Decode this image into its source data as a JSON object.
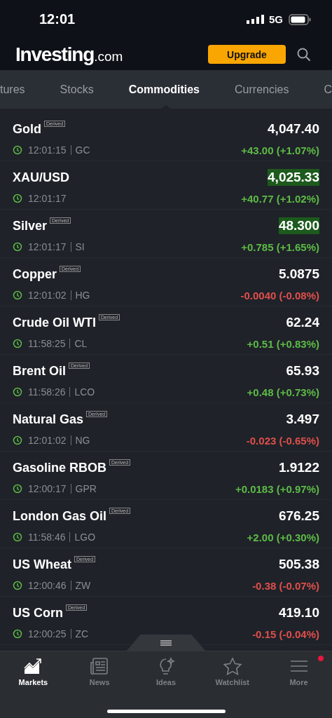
{
  "status_bar": {
    "time": "12:01",
    "network": "5G"
  },
  "header": {
    "logo_main": "Investing",
    "logo_suffix": ".com",
    "upgrade_button": "Upgrade"
  },
  "tabs": [
    {
      "label": "tures",
      "selected": false
    },
    {
      "label": "Stocks",
      "selected": false
    },
    {
      "label": "Commodities",
      "selected": true
    },
    {
      "label": "Currencies",
      "selected": false
    },
    {
      "label": "C",
      "selected": false
    }
  ],
  "rows": [
    {
      "name": "Gold",
      "badge": "Derived",
      "price": "4,047.40",
      "flash": false,
      "time": "12:01:15",
      "symbol": "GC",
      "change": "+43.00 (+1.07%)",
      "color": "#5dbb46"
    },
    {
      "name": "XAU/USD",
      "price": "4,025.33",
      "flash": true,
      "time": "12:01:17",
      "change": "+40.77 (+1.02%)",
      "color": "#5dbb46"
    },
    {
      "name": "Silver",
      "badge": "Derived",
      "price": "48.300",
      "flash": true,
      "time": "12:01:17",
      "symbol": "SI",
      "change": "+0.785 (+1.65%)",
      "color": "#5dbb46"
    },
    {
      "name": "Copper",
      "badge": "Derived",
      "price": "5.0875",
      "flash": false,
      "time": "12:01:02",
      "symbol": "HG",
      "change": "-0.0040 (-0.08%)",
      "color": "#e04f4b"
    },
    {
      "name": "Crude Oil WTI",
      "badge": "Derived",
      "price": "62.24",
      "flash": false,
      "time": "11:58:25",
      "symbol": "CL",
      "change": "+0.51 (+0.83%)",
      "color": "#5dbb46"
    },
    {
      "name": "Brent Oil",
      "badge": "Derived",
      "price": "65.93",
      "flash": false,
      "time": "11:58:26",
      "symbol": "LCO",
      "change": "+0.48 (+0.73%)",
      "color": "#5dbb46"
    },
    {
      "name": "Natural Gas",
      "badge": "Derived",
      "price": "3.497",
      "flash": false,
      "time": "12:01:02",
      "symbol": "NG",
      "change": "-0.023 (-0.65%)",
      "color": "#e04f4b"
    },
    {
      "name": "Gasoline RBOB",
      "badge": "Derived",
      "price": "1.9122",
      "flash": false,
      "time": "12:00:17",
      "symbol": "GPR",
      "change": "+0.0183 (+0.97%)",
      "color": "#5dbb46"
    },
    {
      "name": "London Gas Oil",
      "badge": "Derived",
      "price": "676.25",
      "flash": false,
      "time": "11:58:46",
      "symbol": "LGO",
      "change": "+2.00 (+0.30%)",
      "color": "#5dbb46"
    },
    {
      "name": "US Wheat",
      "badge": "Derived",
      "price": "505.38",
      "flash": false,
      "time": "12:00:46",
      "symbol": "ZW",
      "change": "-0.38 (-0.07%)",
      "color": "#e04f4b"
    },
    {
      "name": "US Corn",
      "badge": "Derived",
      "price": "419.10",
      "flash": false,
      "time": "12:00:25",
      "symbol": "ZC",
      "change": "-0.15 (-0.04%)",
      "color": "#e04f4b"
    }
  ],
  "bottom_nav": [
    {
      "label": "Markets",
      "kind": "markets",
      "selected": true
    },
    {
      "label": "News",
      "kind": "news",
      "selected": false
    },
    {
      "label": "Ideas",
      "kind": "ideas",
      "selected": false
    },
    {
      "label": "Watchlist",
      "kind": "watchlist",
      "selected": false
    },
    {
      "label": "More",
      "kind": "more",
      "selected": false,
      "notification": true
    }
  ]
}
